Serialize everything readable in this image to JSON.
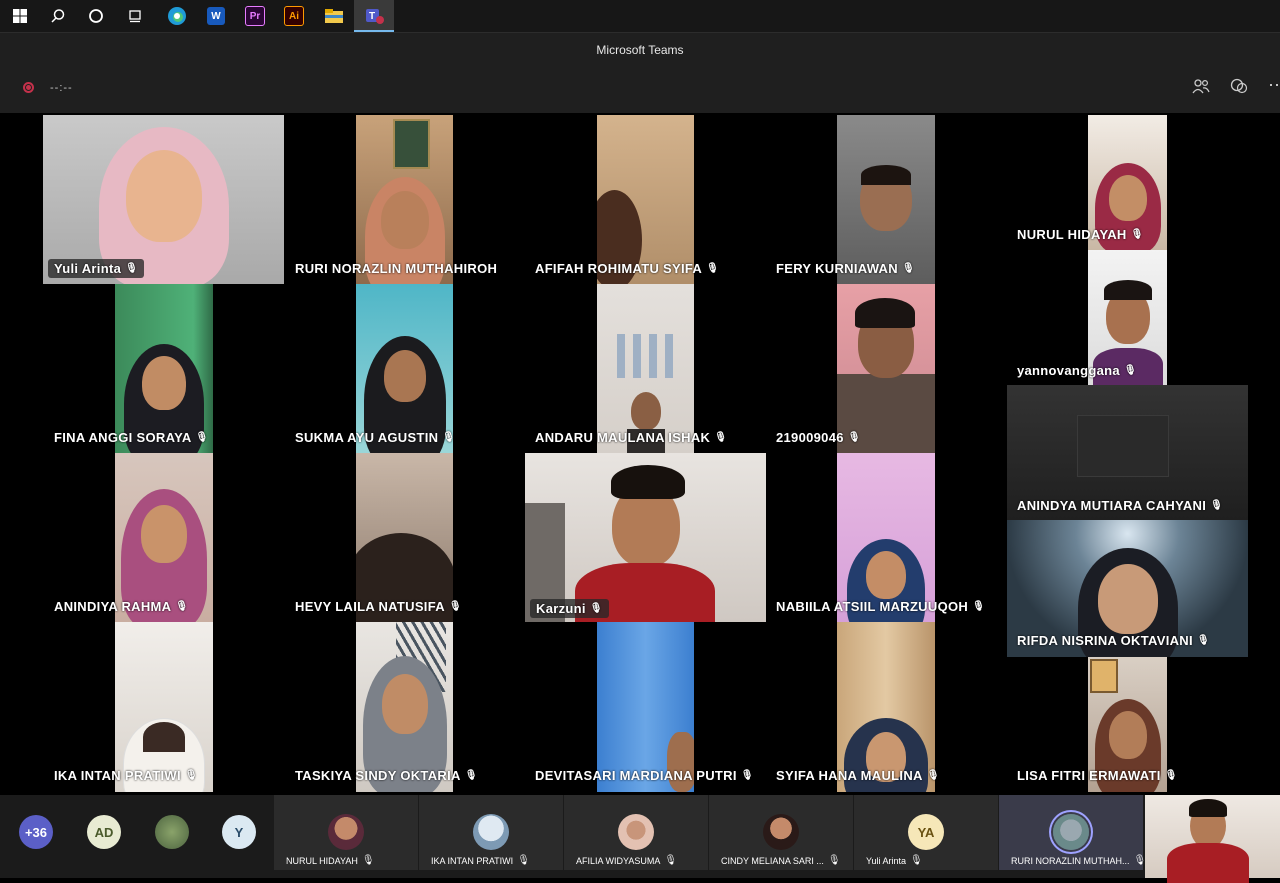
{
  "taskbar": {
    "icons": [
      "windows-start-icon",
      "search-icon",
      "cortana-icon",
      "task-view-icon",
      "edge-icon",
      "word-icon",
      "premiere-icon",
      "illustrator-icon",
      "file-explorer-icon",
      "teams-icon"
    ],
    "word": "W",
    "premiere": "Pr",
    "illustrator": "Ai"
  },
  "window": {
    "title": "Microsoft Teams"
  },
  "controls": {
    "timer": "--:--"
  },
  "participants": [
    {
      "name": "Yuli Arinta"
    },
    {
      "name": "RURI NORAZLIN MUTHAHIROH"
    },
    {
      "name": "AFIFAH ROHIMATU SYIFA"
    },
    {
      "name": "FERY KURNIAWAN"
    },
    {
      "name": "NURUL HIDAYAH"
    },
    {
      "name": "FINA ANGGI SORAYA"
    },
    {
      "name": "SUKMA AYU AGUSTIN"
    },
    {
      "name": "ANDARU MAULANA ISHAK"
    },
    {
      "name": "219009046"
    },
    {
      "name": "yannovanggana"
    },
    {
      "name": "ANINDYA MUTIARA CAHYANI"
    },
    {
      "name": "ANINDIYA RAHMA"
    },
    {
      "name": "HEVY LAILA NATUSIFA"
    },
    {
      "name": "Karzuni"
    },
    {
      "name": "NABIILA ATSIIL MARZUUQOH"
    },
    {
      "name": "RIFDA NISRINA OKTAVIANI"
    },
    {
      "name": "IKA INTAN PRATIWI"
    },
    {
      "name": "TASKIYA SINDY OKTARIA"
    },
    {
      "name": "DEVITASARI MARDIANA PUTRI"
    },
    {
      "name": "SYIFA HANA MAULINA"
    },
    {
      "name": "LISA FITRI ERMAWATI"
    }
  ],
  "bottom": {
    "overflow": "+36",
    "avatars": [
      "AD",
      "Y"
    ],
    "strip": [
      {
        "name": "NURUL HIDAYAH"
      },
      {
        "name": "IKA INTAN PRATIWI"
      },
      {
        "name": "AFILIA WIDYASUMA"
      },
      {
        "name": "CINDY MELIANA SARI ..."
      },
      {
        "name": "Yuli Arinta",
        "initials": "YA"
      },
      {
        "name": "RURI NORAZLIN MUTHAH..."
      }
    ]
  },
  "colors": {
    "accent": "#6264a7",
    "record": "#c4314b",
    "speaking": "#9ea2ff"
  }
}
